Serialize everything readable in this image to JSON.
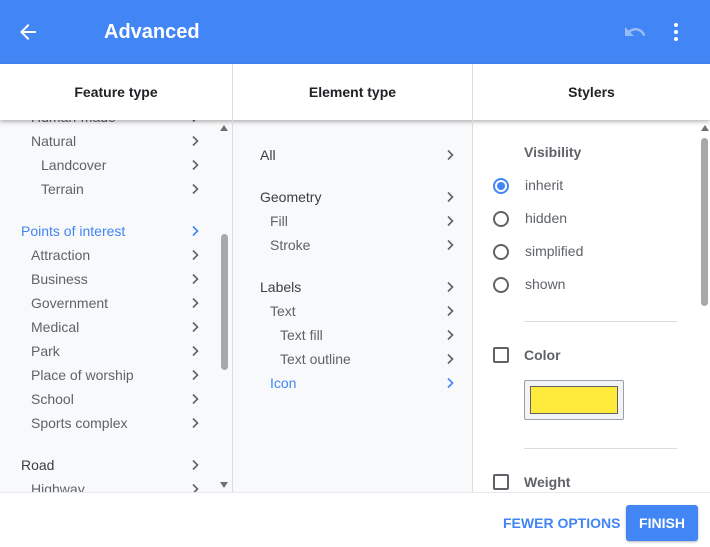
{
  "header": {
    "title": "Advanced",
    "back_icon": "arrow-back-icon",
    "undo_icon": "undo-icon",
    "more_icon": "more-vert-icon"
  },
  "columns": {
    "feature_type": "Feature type",
    "element_type": "Element type",
    "stylers": "Stylers"
  },
  "feature_list": [
    "Human-made",
    "Natural",
    "Landcover",
    "Terrain",
    "Points of interest",
    "Attraction",
    "Business",
    "Government",
    "Medical",
    "Park",
    "Place of worship",
    "School",
    "Sports complex",
    "Road",
    "Highway"
  ],
  "selected_feature": "Points of interest",
  "element_list": [
    "All",
    "Geometry",
    "Fill",
    "Stroke",
    "Labels",
    "Text",
    "Text fill",
    "Text outline",
    "Icon"
  ],
  "selected_element": "Icon",
  "stylers": {
    "visibility_title": "Visibility",
    "visibility_options": [
      "inherit",
      "hidden",
      "simplified",
      "shown"
    ],
    "visibility_selected": "inherit",
    "color_label": "Color",
    "color_checked": false,
    "color_value": "#ffeb3b",
    "weight_label": "Weight",
    "weight_checked": false
  },
  "footer": {
    "fewer_options": "FEWER OPTIONS",
    "finish": "FINISH"
  },
  "colors": {
    "accent": "#4285f4",
    "header_bg": "#4285f4",
    "panel_bg": "#f8f9fa",
    "text_secondary": "#5f6368"
  }
}
